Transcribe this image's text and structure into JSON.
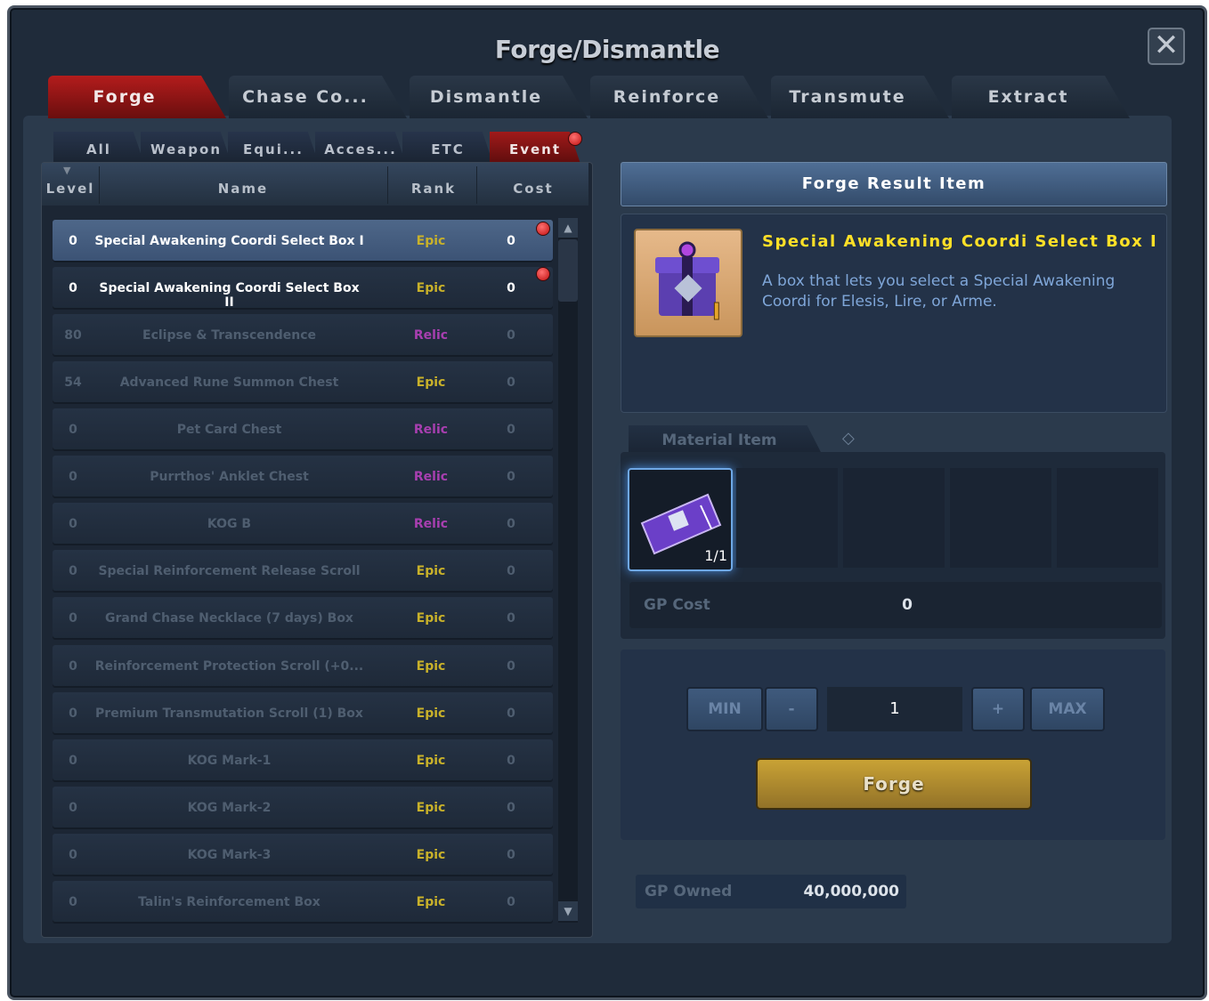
{
  "window": {
    "title": "Forge/Dismantle",
    "close": "✕"
  },
  "tabs": [
    "Forge",
    "Chase Co...",
    "Dismantle",
    "Reinforce",
    "Transmute",
    "Extract"
  ],
  "subtabs": [
    "All",
    "Weapon",
    "Equi...",
    "Acces...",
    "ETC",
    "Event"
  ],
  "list": {
    "columns": {
      "level": "Level",
      "name": "Name",
      "rank": "Rank",
      "cost": "Cost"
    },
    "rows": [
      {
        "level": "0",
        "name": "Special Awakening Coordi Select Box I",
        "rank": "Epic",
        "cost": "0"
      },
      {
        "level": "0",
        "name": "Special Awakening Coordi Select Box II",
        "rank": "Epic",
        "cost": "0"
      },
      {
        "level": "80",
        "name": "Eclipse & Transcendence",
        "rank": "Relic",
        "cost": "0"
      },
      {
        "level": "54",
        "name": "Advanced Rune Summon Chest",
        "rank": "Epic",
        "cost": "0"
      },
      {
        "level": "0",
        "name": "Pet Card Chest",
        "rank": "Relic",
        "cost": "0"
      },
      {
        "level": "0",
        "name": "Purrthos' Anklet Chest",
        "rank": "Relic",
        "cost": "0"
      },
      {
        "level": "0",
        "name": "KOG B",
        "rank": "Relic",
        "cost": "0"
      },
      {
        "level": "0",
        "name": "Special Reinforcement Release Scroll",
        "rank": "Epic",
        "cost": "0"
      },
      {
        "level": "0",
        "name": "Grand Chase Necklace (7 days) Box",
        "rank": "Epic",
        "cost": "0"
      },
      {
        "level": "0",
        "name": "Reinforcement Protection Scroll (+0...",
        "rank": "Epic",
        "cost": "0"
      },
      {
        "level": "0",
        "name": "Premium Transmutation Scroll (1) Box",
        "rank": "Epic",
        "cost": "0"
      },
      {
        "level": "0",
        "name": "KOG Mark-1",
        "rank": "Epic",
        "cost": "0"
      },
      {
        "level": "0",
        "name": "KOG Mark-2",
        "rank": "Epic",
        "cost": "0"
      },
      {
        "level": "0",
        "name": "KOG Mark-3",
        "rank": "Epic",
        "cost": "0"
      },
      {
        "level": "0",
        "name": "Talin's Reinforcement Box",
        "rank": "Epic",
        "cost": "0"
      }
    ]
  },
  "result": {
    "header": "Forge Result Item",
    "item_name": "Special Awakening Coordi Select Box I",
    "description": "A box that lets you select a Special Awakening Coordi for Elesis, Lire, or Arme."
  },
  "material": {
    "tab_label": "Material Item",
    "slot_count": "1/1",
    "gp_cost_label": "GP Cost",
    "gp_cost_value": "0"
  },
  "quantity": {
    "min": "MIN",
    "minus": "-",
    "value": "1",
    "plus": "+",
    "max": "MAX",
    "forge": "Forge"
  },
  "owned": {
    "label": "GP Owned",
    "value": "40,000,000"
  },
  "colors": {
    "epic": "#c8b12a",
    "relic": "#a83fb0",
    "active_tab": "#b31c1c",
    "result_title": "#ffe027"
  }
}
